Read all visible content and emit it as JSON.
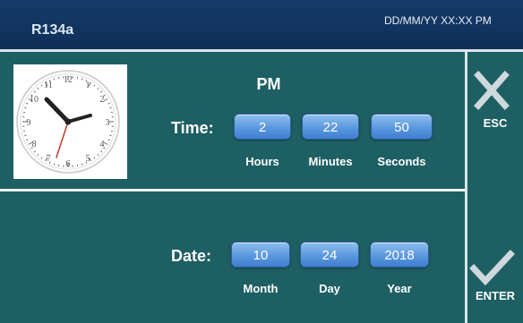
{
  "header": {
    "title": "R134a",
    "datetime": "DD/MM/YY XX:XX PM"
  },
  "time": {
    "ampm": "PM",
    "label": "Time:",
    "hours": "2",
    "minutes": "22",
    "seconds": "50",
    "hours_label": "Hours",
    "minutes_label": "Minutes",
    "seconds_label": "Seconds"
  },
  "date": {
    "label": "Date:",
    "month": "10",
    "day": "24",
    "year": "2018",
    "month_label": "Month",
    "day_label": "Day",
    "year_label": "Year"
  },
  "side": {
    "esc_label": "ESC",
    "enter_label": "ENTER"
  },
  "icons": {
    "clock": "analog-clock-icon",
    "esc": "x-icon",
    "enter": "checkmark-icon"
  },
  "colors": {
    "header_bg": "#123669",
    "panel_bg": "#1e5f63",
    "field_blue": "#5a98df"
  }
}
